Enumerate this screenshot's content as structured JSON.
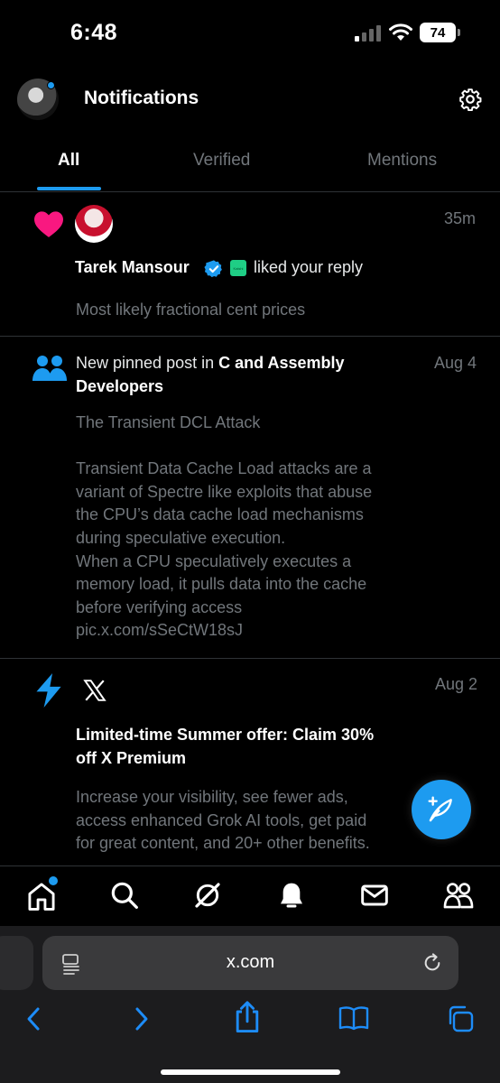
{
  "status_bar": {
    "time": "6:48",
    "battery": "74"
  },
  "header": {
    "title": "Notifications"
  },
  "tabs": [
    {
      "label": "All"
    },
    {
      "label": "Verified"
    },
    {
      "label": "Mentions"
    }
  ],
  "notifications": [
    {
      "type": "like",
      "time": "35m",
      "user": "Tarek Mansour",
      "affiliate_badge": "Kalshi",
      "action": "liked your reply",
      "body": "Most likely fractional cent prices"
    },
    {
      "type": "community",
      "time": "Aug 4",
      "title_prefix": "New pinned post in ",
      "title_bold": "C and Assembly Developers",
      "body_lines": [
        "The Transient DCL Attack",
        "",
        "Transient Data Cache Load attacks are a",
        "variant of Spectre like exploits that abuse",
        "the CPU’s data cache load mechanisms",
        "during speculative execution.",
        "When a CPU speculatively executes a",
        "memory load, it pulls data into the cache",
        "before verifying access",
        "pic.x.com/sSeCtW18sJ"
      ]
    },
    {
      "type": "promo",
      "time": "Aug 2",
      "title_lines": [
        "Limited-time Summer offer: Claim 30%",
        "off X Premium"
      ],
      "body_lines": [
        "Increase your visibility, see fewer ads,",
        "access enhanced Grok AI tools, get paid",
        "for great content, and 20+ other benefits."
      ]
    }
  ],
  "bottom_nav": [
    "home-icon",
    "search-icon",
    "grok-icon",
    "notifications-icon",
    "messages-icon",
    "communities-icon"
  ],
  "browser": {
    "url": "x.com"
  },
  "colors": {
    "accent": "#1d9bf0",
    "like": "#f91880",
    "background": "#000000"
  }
}
